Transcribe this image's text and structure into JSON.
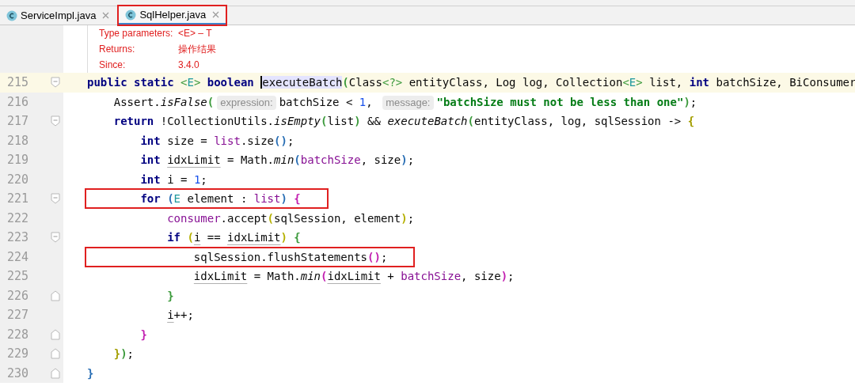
{
  "tabs": [
    {
      "label": "ServiceImpl.java",
      "selected": false,
      "annotated": false
    },
    {
      "label": "SqlHelper.java",
      "selected": true,
      "annotated": true
    }
  ],
  "doc": [
    {
      "label": "Type parameters:",
      "value": "<E> – T"
    },
    {
      "label": "Returns:",
      "value": "操作结果"
    },
    {
      "label": "Since:",
      "value": "3.4.0"
    }
  ],
  "lines": [
    {
      "number": "215",
      "current": true,
      "annotated": false,
      "fold_start": true,
      "fold_end": false,
      "tokens": [
        {
          "text": "public static ",
          "kind": "kw"
        },
        {
          "text": "<",
          "kind": "tb"
        },
        {
          "text": "E",
          "kind": "tp"
        },
        {
          "text": ">",
          "kind": "tb"
        },
        {
          "text": " boolean ",
          "kind": "kw"
        },
        {
          "text": "executeBatch",
          "kind": "hl"
        },
        {
          "text": "(",
          "kind": "br",
          "color": "#3c9a3c"
        },
        {
          "text": "Class",
          "kind": "p"
        },
        {
          "text": "<?>",
          "kind": "tb"
        },
        {
          "text": " entityClass, Log log, Collection",
          "kind": "p"
        },
        {
          "text": "<",
          "kind": "tb"
        },
        {
          "text": "E",
          "kind": "tp"
        },
        {
          "text": ">",
          "kind": "tb"
        },
        {
          "text": " list, ",
          "kind": "p"
        },
        {
          "text": "int",
          "kind": "kw"
        },
        {
          "text": " batchSize, BiConsumer",
          "kind": "p"
        }
      ]
    },
    {
      "number": "216",
      "current": false,
      "annotated": false,
      "fold_start": false,
      "fold_end": false,
      "tokens": [
        {
          "text": "    Assert.",
          "kind": "p"
        },
        {
          "text": "isFalse",
          "kind": "it"
        },
        {
          "text": "(",
          "kind": "br",
          "color": "#3c9a3c"
        },
        {
          "text": "expression:",
          "kind": "hint"
        },
        {
          "text": "batchSize < ",
          "kind": "p"
        },
        {
          "text": "1",
          "kind": "num"
        },
        {
          "text": ", ",
          "kind": "p"
        },
        {
          "text": "message:",
          "kind": "hint"
        },
        {
          "text": "\"batchSize must not be less than one\"",
          "kind": "str"
        },
        {
          "text": ")",
          "kind": "br",
          "color": "#3c9a3c"
        },
        {
          "text": ";",
          "kind": "p"
        }
      ]
    },
    {
      "number": "217",
      "current": false,
      "annotated": false,
      "fold_start": true,
      "fold_end": false,
      "tokens": [
        {
          "text": "    return",
          "kind": "kw"
        },
        {
          "text": " !CollectionUtils.",
          "kind": "p"
        },
        {
          "text": "isEmpty",
          "kind": "it"
        },
        {
          "text": "(",
          "kind": "br",
          "color": "#3c9a3c"
        },
        {
          "text": "list",
          "kind": "p"
        },
        {
          "text": ")",
          "kind": "br",
          "color": "#3c9a3c"
        },
        {
          "text": " && ",
          "kind": "p"
        },
        {
          "text": "executeBatch",
          "kind": "it"
        },
        {
          "text": "(",
          "kind": "br",
          "color": "#3c9a3c"
        },
        {
          "text": "entityClass, log, sqlSession -> ",
          "kind": "p"
        },
        {
          "text": "{",
          "kind": "br",
          "color": "#a39e00"
        }
      ]
    },
    {
      "number": "218",
      "current": false,
      "annotated": false,
      "fold_start": false,
      "fold_end": false,
      "tokens": [
        {
          "text": "        int",
          "kind": "kw"
        },
        {
          "text": " size = ",
          "kind": "p"
        },
        {
          "text": "list",
          "kind": "fld"
        },
        {
          "text": ".size",
          "kind": "p"
        },
        {
          "text": "()",
          "kind": "br",
          "color": "#2a6fb5"
        },
        {
          "text": ";",
          "kind": "p"
        }
      ]
    },
    {
      "number": "219",
      "current": false,
      "annotated": false,
      "fold_start": false,
      "fold_end": false,
      "tokens": [
        {
          "text": "        int ",
          "kind": "kw"
        },
        {
          "text": "idxLimit",
          "kind": "re"
        },
        {
          "text": " = Math.",
          "kind": "p"
        },
        {
          "text": "min",
          "kind": "it"
        },
        {
          "text": "(",
          "kind": "br",
          "color": "#2a6fb5"
        },
        {
          "text": "batchSize",
          "kind": "fld"
        },
        {
          "text": ", size",
          "kind": "p"
        },
        {
          "text": ")",
          "kind": "br",
          "color": "#2a6fb5"
        },
        {
          "text": ";",
          "kind": "p"
        }
      ]
    },
    {
      "number": "220",
      "current": false,
      "annotated": false,
      "fold_start": false,
      "fold_end": false,
      "tokens": [
        {
          "text": "        int",
          "kind": "kw"
        },
        {
          "text": " i = ",
          "kind": "p"
        },
        {
          "text": "1",
          "kind": "num"
        },
        {
          "text": ";",
          "kind": "p"
        }
      ]
    },
    {
      "number": "221",
      "current": false,
      "annotated": true,
      "fold_start": true,
      "fold_end": false,
      "tokens": [
        {
          "text": "        for ",
          "kind": "kw"
        },
        {
          "text": "(",
          "kind": "br",
          "color": "#2a6fb5"
        },
        {
          "text": "E",
          "kind": "tp"
        },
        {
          "text": " element : ",
          "kind": "p"
        },
        {
          "text": "list",
          "kind": "fld"
        },
        {
          "text": ") ",
          "kind": "br",
          "color": "#2a6fb5"
        },
        {
          "text": "{",
          "kind": "br",
          "color": "#c21fb0"
        }
      ]
    },
    {
      "number": "222",
      "current": false,
      "annotated": false,
      "fold_start": false,
      "fold_end": false,
      "tokens": [
        {
          "text": "            consumer",
          "kind": "fld"
        },
        {
          "text": ".accept",
          "kind": "p"
        },
        {
          "text": "(",
          "kind": "br",
          "color": "#b5b000"
        },
        {
          "text": "sqlSession, element",
          "kind": "p"
        },
        {
          "text": ")",
          "kind": "br",
          "color": "#b5b000"
        },
        {
          "text": ";",
          "kind": "p"
        }
      ]
    },
    {
      "number": "223",
      "current": false,
      "annotated": false,
      "fold_start": true,
      "fold_end": false,
      "tokens": [
        {
          "text": "            if ",
          "kind": "kw"
        },
        {
          "text": "(",
          "kind": "br",
          "color": "#b5b000"
        },
        {
          "text": "i",
          "kind": "re"
        },
        {
          "text": " == ",
          "kind": "p"
        },
        {
          "text": "idxLimit",
          "kind": "re"
        },
        {
          "text": ") ",
          "kind": "br",
          "color": "#b5b000"
        },
        {
          "text": "{",
          "kind": "br",
          "color": "#3c9a3c"
        }
      ]
    },
    {
      "number": "224",
      "current": false,
      "annotated": true,
      "fold_start": false,
      "fold_end": false,
      "tokens": [
        {
          "text": "                sqlSession.flushStatements",
          "kind": "p"
        },
        {
          "text": "()",
          "kind": "br",
          "color": "#c21fb0"
        },
        {
          "text": ";",
          "kind": "p"
        }
      ]
    },
    {
      "number": "225",
      "current": false,
      "annotated": false,
      "fold_start": false,
      "fold_end": false,
      "tokens": [
        {
          "text": "                idxLimit",
          "kind": "re"
        },
        {
          "text": " = Math.",
          "kind": "p"
        },
        {
          "text": "min",
          "kind": "it"
        },
        {
          "text": "(",
          "kind": "br",
          "color": "#c21fb0"
        },
        {
          "text": "idxLimit",
          "kind": "re"
        },
        {
          "text": " + ",
          "kind": "p"
        },
        {
          "text": "batchSize",
          "kind": "fld"
        },
        {
          "text": ", size",
          "kind": "p"
        },
        {
          "text": ")",
          "kind": "br",
          "color": "#c21fb0"
        },
        {
          "text": ";",
          "kind": "p"
        }
      ]
    },
    {
      "number": "226",
      "current": false,
      "annotated": false,
      "fold_start": false,
      "fold_end": true,
      "tokens": [
        {
          "text": "            }",
          "kind": "br",
          "color": "#3c9a3c"
        }
      ]
    },
    {
      "number": "227",
      "current": false,
      "annotated": false,
      "fold_start": false,
      "fold_end": false,
      "tokens": [
        {
          "text": "            i",
          "kind": "re"
        },
        {
          "text": "++;",
          "kind": "p"
        }
      ]
    },
    {
      "number": "228",
      "current": false,
      "annotated": false,
      "fold_start": false,
      "fold_end": true,
      "tokens": [
        {
          "text": "        }",
          "kind": "br",
          "color": "#c21fb0"
        }
      ]
    },
    {
      "number": "229",
      "current": false,
      "annotated": false,
      "fold_start": false,
      "fold_end": true,
      "tokens": [
        {
          "text": "    }",
          "kind": "br",
          "color": "#a39e00"
        },
        {
          "text": ")",
          "kind": "br",
          "color": "#3c9a3c"
        },
        {
          "text": ";",
          "kind": "p"
        }
      ]
    },
    {
      "number": "230",
      "current": false,
      "annotated": false,
      "fold_start": false,
      "fold_end": true,
      "tokens": [
        {
          "text": "}",
          "kind": "br",
          "color": "#2a6fb5"
        }
      ]
    }
  ]
}
